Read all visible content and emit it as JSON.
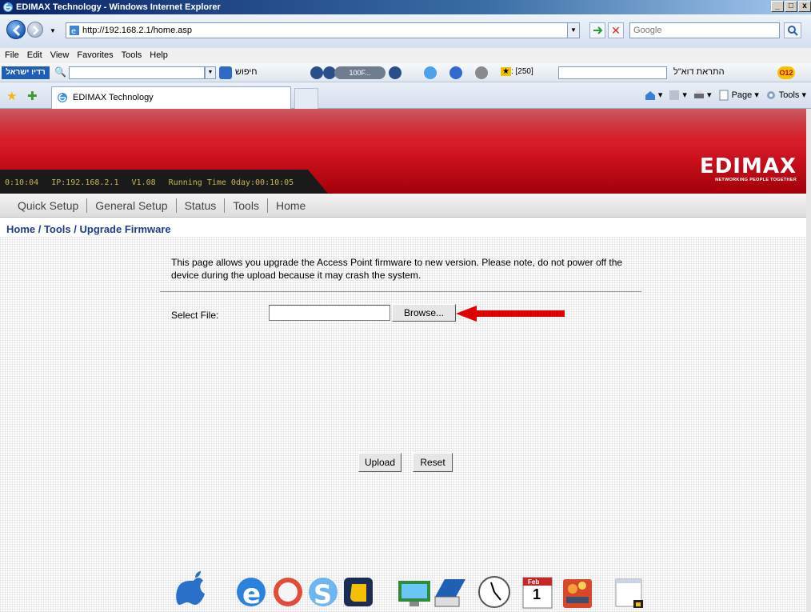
{
  "window": {
    "title": "EDIMAX Technology - Windows Internet Explorer",
    "btn_min": "_",
    "btn_max": "□",
    "btn_close": "x"
  },
  "address_bar": {
    "url": "http://192.168.2.1/home.asp",
    "search_placeholder": "Google"
  },
  "menu": [
    "File",
    "Edit",
    "View",
    "Favorites",
    "Tools",
    "Help"
  ],
  "toolbar": {
    "logo_text": "רדיו ישראל",
    "search_label": "חיפוש",
    "pill_text": "100F...",
    "badge_text": ": [250]",
    "heb_text": "התראת דוא\"ל",
    "o12": "O12"
  },
  "tab": {
    "title": "EDIMAX Technology"
  },
  "command_bar": {
    "page": "Page",
    "tools": "Tools"
  },
  "banner": {
    "clock": "0:10:04",
    "ip": "IP:192.168.2.1",
    "version": "V1.08",
    "running_time": "Running Time 0day:00:10:05",
    "brand": "EDIMAX",
    "tagline": "NETWORKING PEOPLE TOGETHER"
  },
  "nav": [
    "Quick Setup",
    "General Setup",
    "Status",
    "Tools",
    "Home"
  ],
  "breadcrumb": "Home / Tools / Upgrade Firmware",
  "page": {
    "description": "This page allows you upgrade the Access Point firmware to new version. Please note, do not power off the device during the upload because it may crash the system.",
    "select_file_label": "Select File:",
    "file_value": "",
    "browse": "Browse...",
    "upload": "Upload",
    "reset": "Reset"
  },
  "dock": [
    "apple-icon",
    "internet-explorer-icon",
    "safari-icon",
    "skype-icon",
    "note-app-icon",
    "network-monitor-icon",
    "scanner-icon",
    "clock-icon",
    "calendar-icon",
    "control-panel-icon",
    "window-preview-icon"
  ],
  "calendar": {
    "month": "Feb",
    "day": "1"
  },
  "colors": {
    "brand_red": "#c8101c",
    "breadcrumb_blue": "#1f3d84",
    "arrow_red": "#e00000"
  }
}
